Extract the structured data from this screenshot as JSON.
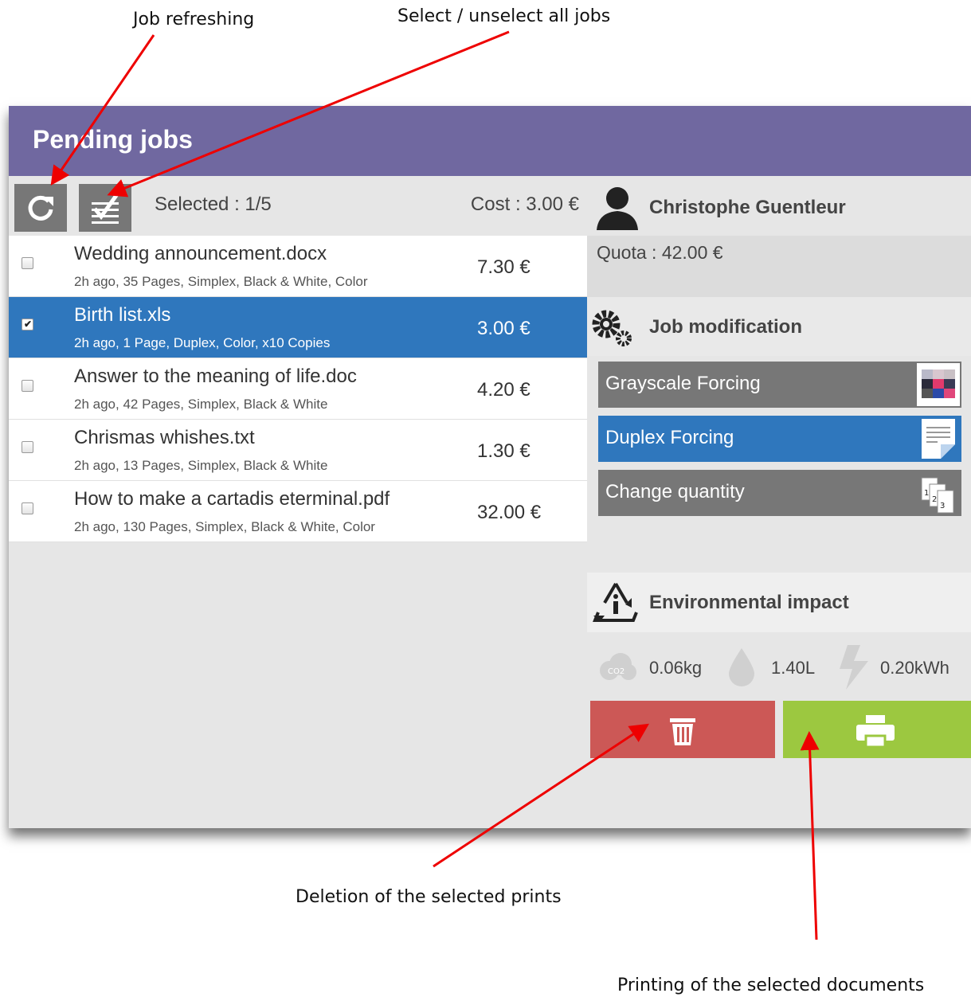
{
  "annotations": {
    "refresh": "Job refreshing",
    "select_all": "Select / unselect all jobs",
    "delete": "Deletion of the selected prints",
    "print": "Printing of the selected documents"
  },
  "panel": {
    "title": "Pending jobs",
    "selected_label": "Selected : 1/5",
    "cost_label": "Cost : 3.00 €"
  },
  "jobs": [
    {
      "name": "Wedding announcement.docx",
      "meta": "2h ago, 35 Pages, Simplex, Black & White, Color",
      "price": "7.30 €",
      "selected": false
    },
    {
      "name": "Birth list.xls",
      "meta": "2h ago, 1 Page, Duplex, Color, x10 Copies",
      "price": "3.00 €",
      "selected": true
    },
    {
      "name": "Answer to the meaning of life.doc",
      "meta": "2h ago, 42 Pages, Simplex, Black & White",
      "price": "4.20 €",
      "selected": false
    },
    {
      "name": "Chrismas whishes.txt",
      "meta": "2h ago, 13 Pages, Simplex, Black & White",
      "price": "1.30 €",
      "selected": false
    },
    {
      "name": "How to make a cartadis eterminal.pdf",
      "meta": "2h ago, 130 Pages, Simplex, Black & White, Color",
      "price": "32.00 €",
      "selected": false
    }
  ],
  "user": {
    "name": "Christophe Guentleur",
    "quota": "Quota : 42.00 €"
  },
  "modification": {
    "title": "Job modification",
    "options": [
      {
        "label": "Grayscale Forcing",
        "active": false
      },
      {
        "label": "Duplex Forcing",
        "active": true
      },
      {
        "label": "Change quantity",
        "active": false
      }
    ]
  },
  "environment": {
    "title": "Environmental impact",
    "co2": "0.06kg",
    "water": "1.40L",
    "energy": "0.20kWh"
  },
  "colors": {
    "header": "#7068a0",
    "selected": "#2f77bd",
    "delete": "#cc5856",
    "print": "#9cc840",
    "annotation_arrow": "#ee0000"
  }
}
